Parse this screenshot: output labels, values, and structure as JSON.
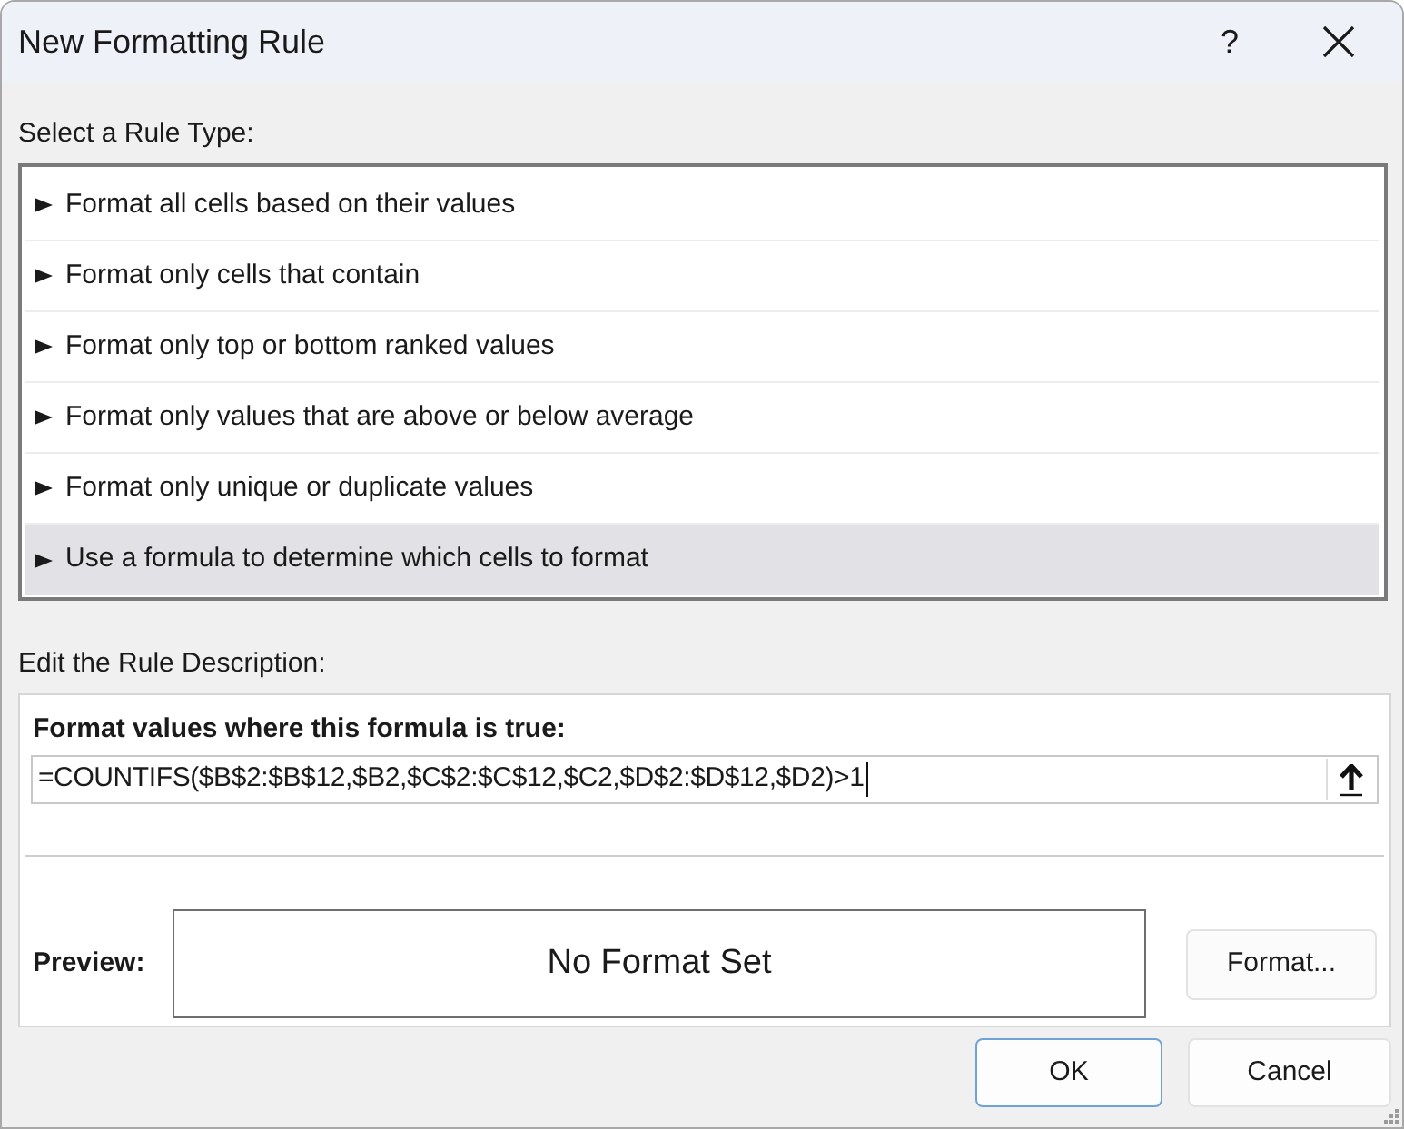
{
  "window": {
    "title": "New Formatting Rule",
    "help_button": "?"
  },
  "rule_type": {
    "label": "Select a Rule Type:",
    "items": [
      {
        "label": "Format all cells based on their values",
        "selected": false
      },
      {
        "label": "Format only cells that contain",
        "selected": false
      },
      {
        "label": "Format only top or bottom ranked values",
        "selected": false
      },
      {
        "label": "Format only values that are above or below average",
        "selected": false
      },
      {
        "label": "Format only unique or duplicate values",
        "selected": false
      },
      {
        "label": "Use a formula to determine which cells to format",
        "selected": true
      }
    ]
  },
  "rule_description": {
    "label": "Edit the Rule Description:",
    "formula_label": "Format values where this formula is true:",
    "formula_field": {
      "value": "=COUNTIFS($B$2:$B$12,$B2,$C$2:$C$12,$C2,$D$2:$D$12,$D2)>1",
      "focused": true
    },
    "preview": {
      "label": "Preview:",
      "sample": "No Format Set"
    },
    "format_button": "Format..."
  },
  "buttons": [
    {
      "label": "OK",
      "default": true
    },
    {
      "label": "Cancel",
      "default": false
    }
  ]
}
